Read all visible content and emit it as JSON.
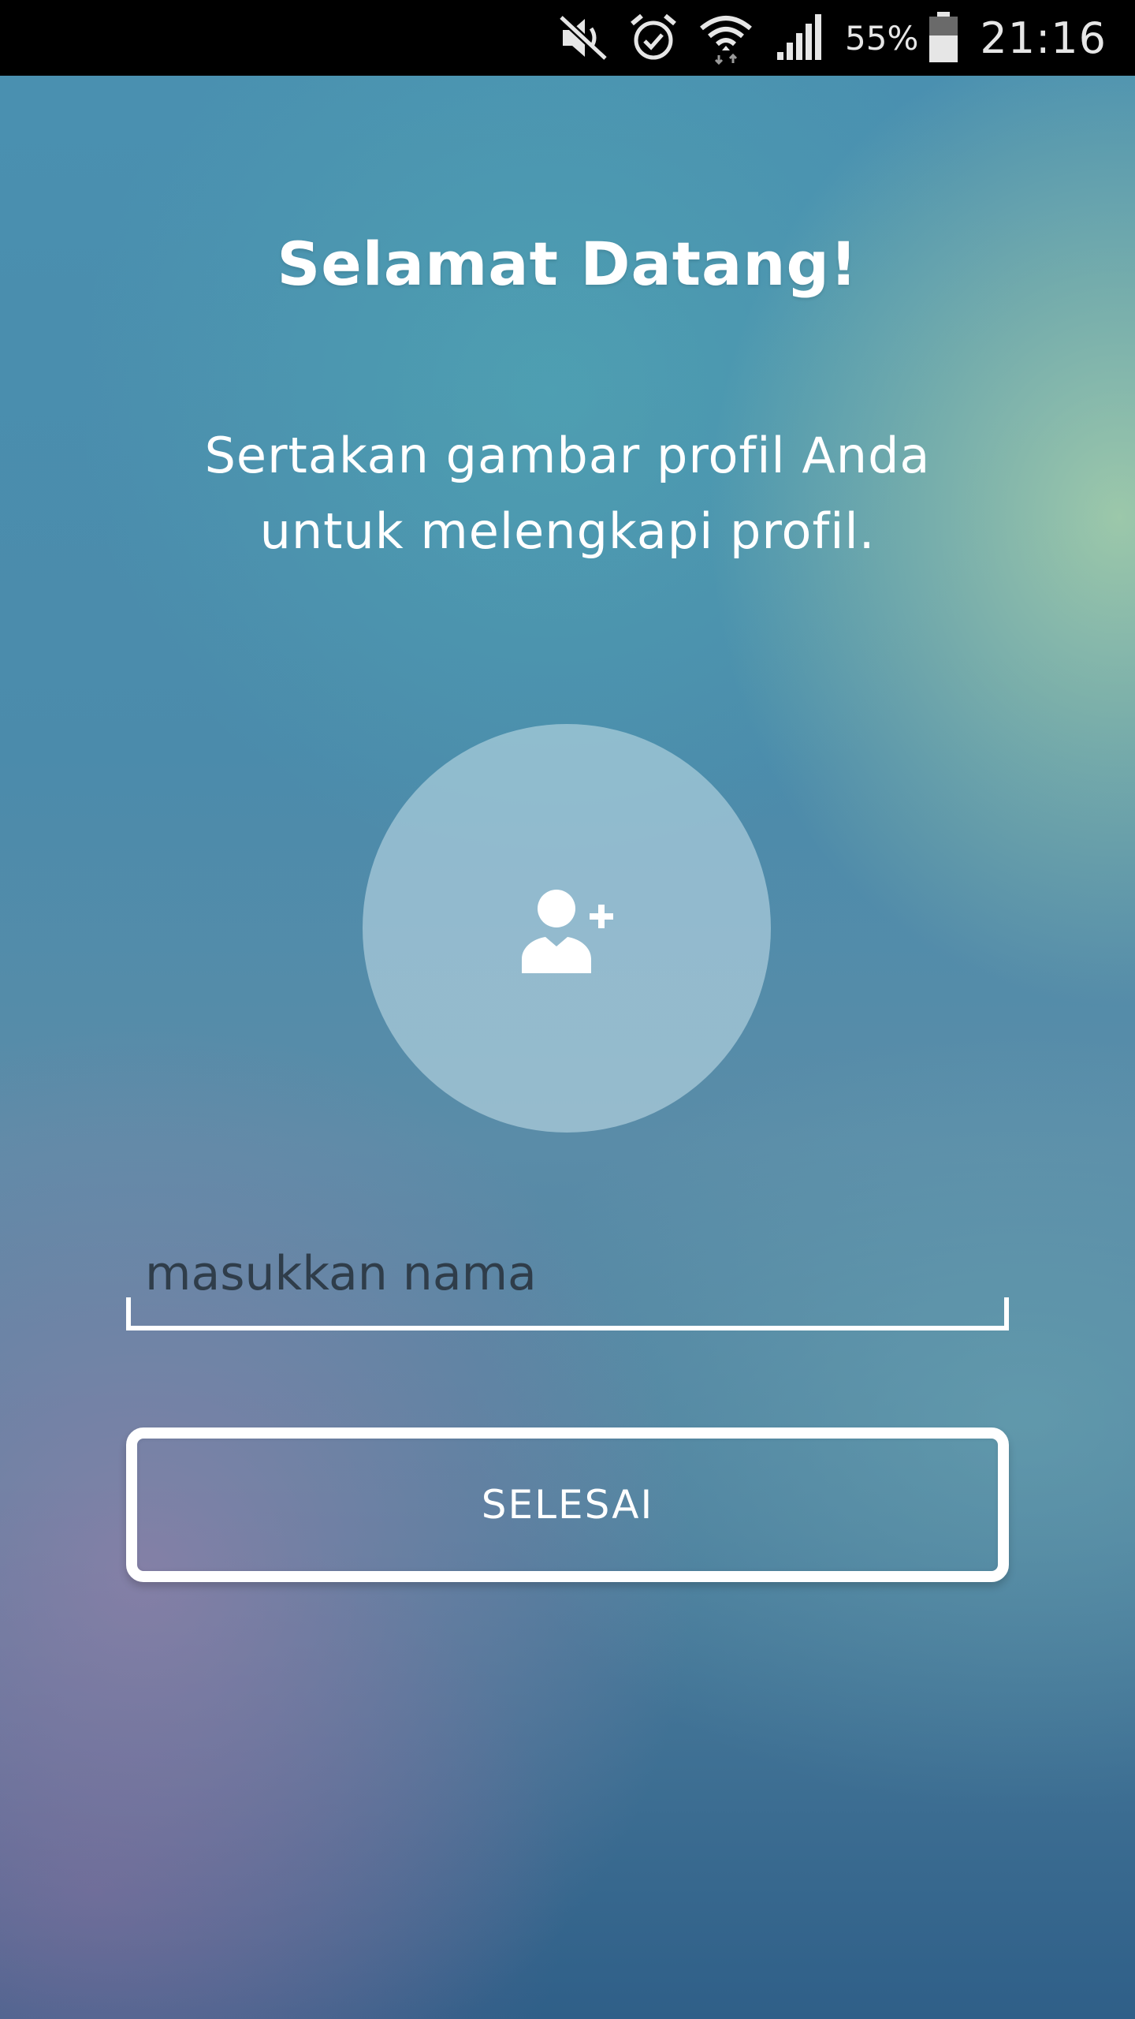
{
  "status_bar": {
    "battery_percent": "55%",
    "time": "21:16",
    "icons": [
      "mute-icon",
      "alarm-icon",
      "wifi-icon",
      "signal-icon",
      "battery-icon"
    ]
  },
  "welcome": {
    "title": "Selamat Datang!",
    "subtitle": "Sertakan gambar profil Anda untuk melengkapi profil."
  },
  "profile": {
    "avatar_icon": "add-user-icon"
  },
  "name_input": {
    "value": "",
    "placeholder": "masukkan nama"
  },
  "actions": {
    "done_label": "SELESAI"
  },
  "colors": {
    "text": "#ffffff",
    "status_bar_bg": "#000000",
    "placeholder": "#2f3d4a"
  }
}
